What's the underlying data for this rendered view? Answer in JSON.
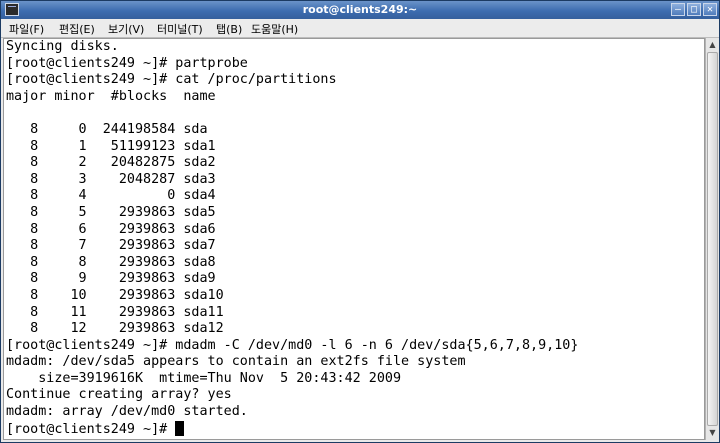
{
  "window": {
    "title": "root@clients249:~",
    "buttons": {
      "minimize": "–",
      "maximize": "□",
      "close": "✕"
    }
  },
  "menu": [
    "파일(F)",
    "편집(E)",
    "보기(V)",
    "터미널(T)",
    "탭(B)",
    "도움말(H)"
  ],
  "terminal": {
    "lines": [
      "Syncing disks.",
      "[root@clients249 ~]# partprobe",
      "[root@clients249 ~]# cat /proc/partitions",
      "major minor  #blocks  name",
      "",
      "   8     0  244198584 sda",
      "   8     1   51199123 sda1",
      "   8     2   20482875 sda2",
      "   8     3    2048287 sda3",
      "   8     4          0 sda4",
      "   8     5    2939863 sda5",
      "   8     6    2939863 sda6",
      "   8     7    2939863 sda7",
      "   8     8    2939863 sda8",
      "   8     9    2939863 sda9",
      "   8    10    2939863 sda10",
      "   8    11    2939863 sda11",
      "   8    12    2939863 sda12",
      "[root@clients249 ~]# mdadm -C /dev/md0 -l 6 -n 6 /dev/sda{5,6,7,8,9,10}",
      "mdadm: /dev/sda5 appears to contain an ext2fs file system",
      "    size=3919616K  mtime=Thu Nov  5 20:43:42 2009",
      "Continue creating array? yes",
      "mdadm: array /dev/md0 started."
    ],
    "prompt": "[root@clients249 ~]# "
  }
}
